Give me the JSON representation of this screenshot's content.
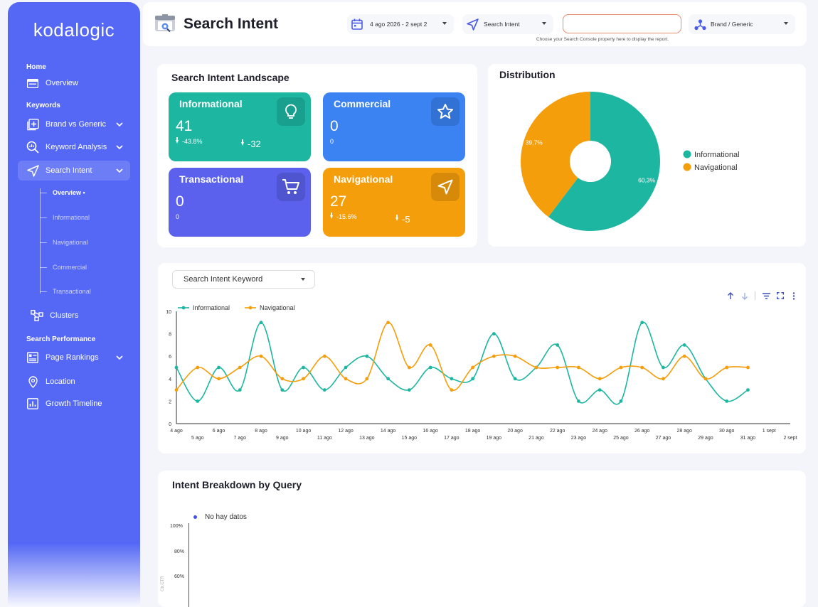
{
  "sidebar": {
    "logo": "kodalogic",
    "sections": {
      "home": "Home",
      "keywords": "Keywords",
      "search_performance": "Search Performance"
    },
    "items": {
      "overview": "Overview",
      "brand_vs_generic": "Brand vs Generic",
      "keyword_analysis": "Keyword Analysis",
      "search_intent": "Search Intent",
      "clusters": "Clusters",
      "page_rankings": "Page Rankings",
      "location": "Location",
      "growth_timeline": "Growth Timeline"
    },
    "sub_items": [
      "Overview •",
      "Informational",
      "Navigational",
      "Commercial",
      "Transactional"
    ]
  },
  "header": {
    "title": "Search Intent",
    "date_range": "4 ago 2026 - 2 sept 2",
    "intent_filter": "Search Intent",
    "property_input": "",
    "property_hint": "Choose your Search Console property here to display the report.",
    "brand_filter": "Brand / Generic"
  },
  "landscape": {
    "title": "Search Intent Landscape",
    "tiles": [
      {
        "name": "Informational",
        "value": "41",
        "sub": "-43.8%",
        "delta": "-32",
        "color": "#1db6a1",
        "icon": "lightbulb-icon"
      },
      {
        "name": "Commercial",
        "value": "0",
        "sub": "0",
        "delta": "",
        "color": "#3b82f3",
        "icon": "star-icon"
      },
      {
        "name": "Transactional",
        "value": "0",
        "sub": "0",
        "delta": "",
        "color": "#5b61ec",
        "icon": "cart-icon"
      },
      {
        "name": "Navigational",
        "value": "27",
        "sub": "-15.6%",
        "delta": "-5",
        "color": "#f59e0b",
        "icon": "navigation-icon"
      }
    ]
  },
  "distribution": {
    "title": "Distribution",
    "legend": [
      "Informational",
      "Navigational"
    ]
  },
  "trend": {
    "dropdown": "Search Intent Keyword"
  },
  "breakdown": {
    "title": "Intent Breakdown by Query",
    "no_data": "No hay datos",
    "y_ticks": [
      "100%",
      "80%",
      "60%"
    ],
    "y_label": "Ctr.CTR"
  },
  "chart_data": [
    {
      "type": "pie",
      "labels": [
        "Informational",
        "Navigational"
      ],
      "values": [
        60.3,
        39.7
      ],
      "data_labels": [
        "60,3%",
        "39,7%"
      ],
      "colors": [
        "#1db6a1",
        "#f59e0b"
      ],
      "legend": "right"
    },
    {
      "type": "line",
      "x": [
        "4 ago",
        "5 ago",
        "6 ago",
        "7 ago",
        "8 ago",
        "9 ago",
        "10 ago",
        "11 ago",
        "12 ago",
        "13 ago",
        "14 ago",
        "15 ago",
        "16 ago",
        "17 ago",
        "18 ago",
        "19 ago",
        "20 ago",
        "21 ago",
        "22 ago",
        "23 ago",
        "24 ago",
        "25 ago",
        "26 ago",
        "27 ago",
        "28 ago",
        "29 ago",
        "30 ago",
        "31 ago",
        "1 sept",
        "2 sept"
      ],
      "series": [
        {
          "name": "Informational",
          "color": "#1db6a1",
          "values": [
            5,
            2,
            5,
            3,
            9,
            3,
            5,
            3,
            5,
            6,
            4,
            3,
            5,
            4,
            4,
            8,
            4,
            5,
            7,
            2,
            3,
            2,
            9,
            5,
            7,
            4,
            2,
            3,
            null,
            null
          ]
        },
        {
          "name": "Navigational",
          "color": "#f59e0b",
          "values": [
            3,
            5,
            4,
            5,
            6,
            4,
            4,
            6,
            4,
            4,
            9,
            5,
            7,
            3,
            5,
            6,
            6,
            5,
            5,
            5,
            4,
            5,
            5,
            4,
            6,
            4,
            5,
            5,
            null,
            null
          ]
        }
      ],
      "ylim": [
        0,
        10
      ],
      "y_ticks": [
        0,
        2,
        4,
        6,
        8,
        10
      ],
      "legend": "top-left",
      "grid": false
    }
  ]
}
